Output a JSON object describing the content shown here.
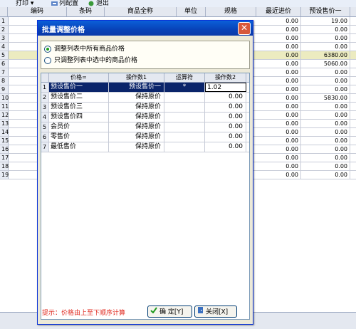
{
  "toolbar": {
    "print_label": "打印 ▾",
    "columns_label": "列配置",
    "exit_label": "退出"
  },
  "grid": {
    "columns": [
      "编码",
      "条码",
      "商品全称",
      "单位",
      "规格",
      "最近进价",
      "预设售价一"
    ],
    "rows": [
      {
        "n": "1",
        "cost": "0.00",
        "price": "19.00"
      },
      {
        "n": "2",
        "cost": "0.00",
        "price": "0.00"
      },
      {
        "n": "3",
        "cost": "0.00",
        "price": "0.00"
      },
      {
        "n": "4",
        "cost": "0.00",
        "price": "0.00"
      },
      {
        "n": "5",
        "cost": "0.00",
        "price": "6380.00"
      },
      {
        "n": "6",
        "cost": "0.00",
        "price": "5060.00"
      },
      {
        "n": "7",
        "cost": "0.00",
        "price": "0.00"
      },
      {
        "n": "8",
        "cost": "0.00",
        "price": "0.00"
      },
      {
        "n": "9",
        "cost": "0.00",
        "price": "0.00"
      },
      {
        "n": "10",
        "cost": "0.00",
        "price": "5830.00"
      },
      {
        "n": "11",
        "cost": "0.00",
        "price": "0.00"
      },
      {
        "n": "12",
        "cost": "0.00",
        "price": "0.00"
      },
      {
        "n": "13",
        "cost": "0.00",
        "price": "0.00"
      },
      {
        "n": "14",
        "cost": "0.00",
        "price": "0.00"
      },
      {
        "n": "15",
        "cost": "0.00",
        "price": "0.00"
      },
      {
        "n": "16",
        "cost": "0.00",
        "price": "0.00"
      },
      {
        "n": "17",
        "cost": "0.00",
        "price": "0.00"
      },
      {
        "n": "18",
        "cost": "0.00",
        "price": "0.00"
      },
      {
        "n": "19",
        "cost": "0.00",
        "price": "0.00"
      }
    ]
  },
  "dialog": {
    "title": "批量调整价格",
    "radio_all": "调整列表中所有商品价格",
    "radio_selected": "只调整列表中选中的商品价格",
    "table_headers": [
      "价格=",
      "操作数1",
      "运算符",
      "操作数2"
    ],
    "rows": [
      {
        "n": "1",
        "price": "预设售价一",
        "op1": "预设售价一",
        "operator": "*",
        "op2": "1.02"
      },
      {
        "n": "2",
        "price": "预设售价二",
        "op1": "保持原价",
        "operator": "",
        "op2": "0.00"
      },
      {
        "n": "3",
        "price": "预设售价三",
        "op1": "保持原价",
        "operator": "",
        "op2": "0.00"
      },
      {
        "n": "4",
        "price": "预设售价四",
        "op1": "保持原价",
        "operator": "",
        "op2": "0.00"
      },
      {
        "n": "5",
        "price": "会员价",
        "op1": "保持原价",
        "operator": "",
        "op2": "0.00"
      },
      {
        "n": "6",
        "price": "零售价",
        "op1": "保持原价",
        "operator": "",
        "op2": "0.00"
      },
      {
        "n": "7",
        "price": "最低售价",
        "op1": "保持原价",
        "operator": "",
        "op2": "0.00"
      }
    ],
    "hint": "提示：价格由上至下顺序计算",
    "ok_label": "确 定[Y]",
    "close_label": "关闭[X]"
  }
}
